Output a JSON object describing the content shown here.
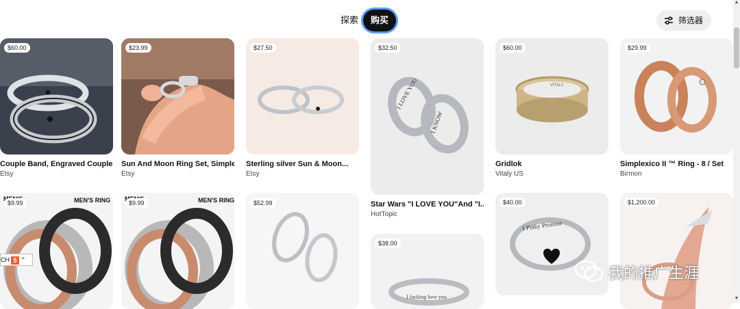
{
  "header": {
    "tabs": [
      {
        "label": "探索"
      },
      {
        "label": "购买"
      }
    ],
    "filter_label": "筛选器"
  },
  "pins": [
    {
      "price": "$60.00",
      "title": "Couple Band, Engraved Couple...",
      "source": "Etsy"
    },
    {
      "price": "$23.99",
      "title": "Sun And Moon Ring Set, Simple...",
      "source": "Etsy"
    },
    {
      "price": "$27.50",
      "title": "Sterling silver Sun & Moon...",
      "source": "Etsy"
    },
    {
      "price": "$32.50",
      "title": "Star Wars \"I LOVE YOU\"And \"I...",
      "source": "HotTopic"
    },
    {
      "price": "$60.00",
      "title": "Gridlok",
      "source": "Vitaly US"
    },
    {
      "price": "$29.99",
      "title": "Simplexico II ™ Ring - 8 / Set",
      "source": "Birmon"
    },
    {
      "price": "$9.99",
      "title": "",
      "source": ""
    },
    {
      "price": "$9.99",
      "title": "",
      "source": ""
    },
    {
      "price": "$52.99",
      "title": "",
      "source": ""
    },
    {
      "price": "$38.00",
      "title": "",
      "source": ""
    },
    {
      "price": "$40.00",
      "title": "",
      "source": ""
    },
    {
      "price": "$1,200.00",
      "title": "",
      "source": ""
    }
  ],
  "image_text": {
    "mens_ring": "MEN'S RING",
    "mens": "MEN'S",
    "ring_text_1": "I LOVE YOU",
    "ring_text_2": "I KNOW",
    "ring_text_3": "VITALY",
    "ring_text_4": "I Pinky Promise",
    "ring_text_5": "I fucking love you"
  },
  "ime_widget": {
    "label": "CH",
    "badge": "5"
  },
  "watermark": {
    "text": "我的推广生涯"
  }
}
